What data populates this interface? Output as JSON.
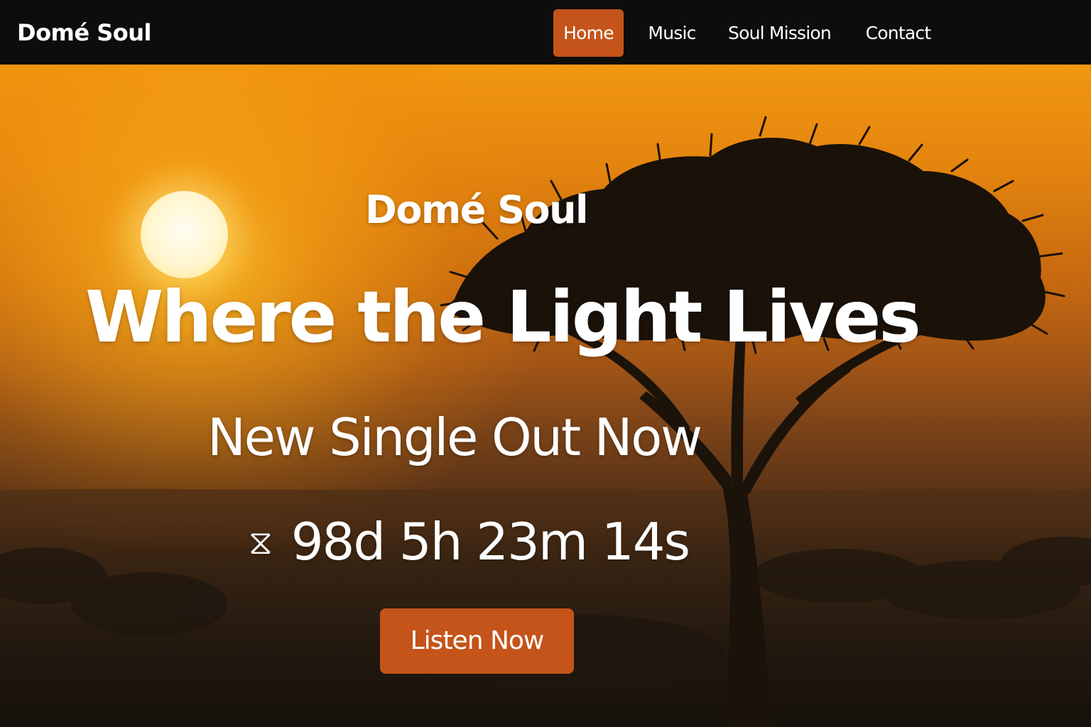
{
  "nav": {
    "brand": "Domé Soul",
    "items": [
      {
        "label": "Home",
        "active": true
      },
      {
        "label": "Music",
        "active": false
      },
      {
        "label": "Soul Mission",
        "active": false
      },
      {
        "label": "Contact",
        "active": false
      }
    ]
  },
  "hero": {
    "artist": "Domé Soul",
    "headline": "Where the Light Lives",
    "subheadline": "New Single Out Now",
    "countdown": {
      "icon": "hourglass-icon",
      "glyph": "⧖",
      "text": "98d 5h 23m 14s"
    },
    "cta_label": "Listen Now",
    "background": "sunset savanna with acacia tree silhouette"
  },
  "colors": {
    "accent": "#c4541a",
    "nav_background": "#0e0d0c",
    "text": "#ffffff"
  }
}
